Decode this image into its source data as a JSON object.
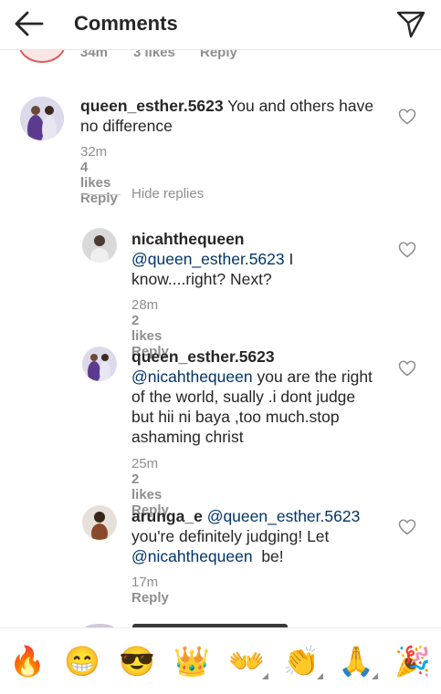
{
  "header": {
    "title": "Comments"
  },
  "partial_comment": {
    "time": "34m",
    "likes": "3 likes",
    "reply": "Reply"
  },
  "comments": [
    {
      "username": "queen_esther.5623",
      "text": "You and others have no difference",
      "time": "32m",
      "likes": "4 likes",
      "reply": "Reply"
    }
  ],
  "hide_replies": "Hide replies",
  "replies": [
    {
      "username": "nicahthequeen",
      "mention": "@queen_esther.5623",
      "text": " I know....right? Next?",
      "time": "28m",
      "likes": "2 likes",
      "reply": "Reply"
    },
    {
      "username": "queen_esther.5623",
      "mention": "@nicahthequeen",
      "text": " you are the right of the world, sually .i dont judge but hii ni baya ,too much.stop ashaming christ",
      "time": "25m",
      "likes": "2 likes",
      "reply": "Reply"
    },
    {
      "username": "arunga_e",
      "mention": "@queen_esther.5623",
      "text_a": " you're definitely judging! Let ",
      "mention2": "@nicahthequeen",
      "text_b": "  be!",
      "time": "17m",
      "reply": "Reply"
    }
  ],
  "emoji_bar": [
    "fire",
    "grinning-squinting-face",
    "smiling-face-with-sunglasses",
    "crown",
    "open-hands",
    "clapping-hands",
    "folded-hands",
    "party-popper"
  ],
  "emoji_chars": [
    "🔥",
    "😁",
    "😎",
    "👑",
    "👐",
    "👏",
    "🙏",
    "🎉"
  ]
}
